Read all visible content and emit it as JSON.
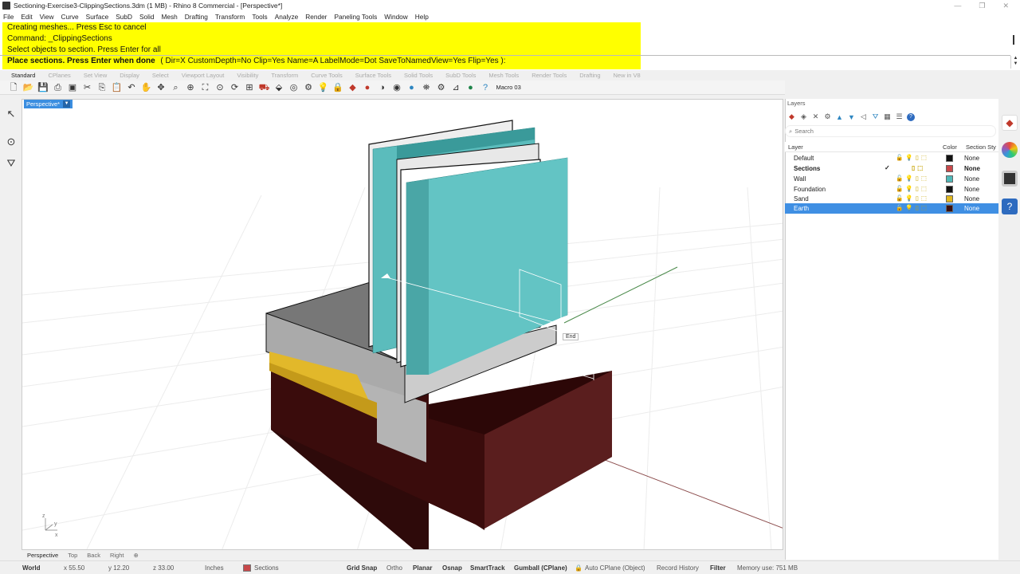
{
  "window": {
    "title": "Sectioning-Exercise3-ClippingSections.3dm (1 MB) - Rhino 8 Commercial - [Perspective*]",
    "controls": [
      "—",
      "❐",
      "✕"
    ]
  },
  "menu": [
    "File",
    "Edit",
    "View",
    "Curve",
    "Surface",
    "SubD",
    "Solid",
    "Mesh",
    "Drafting",
    "Transform",
    "Tools",
    "Analyze",
    "Render",
    "Paneling Tools",
    "Window",
    "Help"
  ],
  "command": {
    "line1": "Creating meshes... Press Esc to cancel",
    "line2": "Command: _ClippingSections",
    "line3": "Select objects to section. Press Enter for all",
    "prompt": "Place sections. Press Enter when done",
    "options": "( Dir=X  CustomDepth=No  Clip=Yes  Name=A  LabelMode=Dot  SaveToNamedView=Yes  Flip=Yes ):",
    "highlight_color": "#ffff00"
  },
  "toolbar_tabs": [
    "Standard",
    "CPlanes",
    "Set View",
    "Display",
    "Select",
    "Viewport Layout",
    "Visibility",
    "Transform",
    "Curve Tools",
    "Surface Tools",
    "Solid Tools",
    "SubD Tools",
    "Mesh Tools",
    "Render Tools",
    "Drafting",
    "New in V8"
  ],
  "toolbar_macro": "Macro 03",
  "viewport": {
    "label": "Perspective*",
    "snap_label": "End",
    "axis_z": "z",
    "axis_y": "y",
    "axis_x": "x"
  },
  "view_tabs": [
    "Perspective",
    "Top",
    "Back",
    "Right",
    "⊕"
  ],
  "status": {
    "cplane": "World",
    "x": "x 55.50",
    "y": "y 12.20",
    "z": "z 33.00",
    "units": "Inches",
    "layer": "Sections",
    "grid_snap": "Grid Snap",
    "ortho": "Ortho",
    "planar": "Planar",
    "osnap": "Osnap",
    "smarttrack": "SmartTrack",
    "gumball": "Gumball (CPlane)",
    "autocplane": "Auto CPlane (Object)",
    "record_history": "Record History",
    "filter": "Filter",
    "memory": "Memory use: 751 MB"
  },
  "layers_panel": {
    "title": "Layers",
    "search_placeholder": "Search",
    "columns": {
      "layer": "Layer",
      "color": "Color",
      "section_style": "Section Sty"
    },
    "rows": [
      {
        "name": "Default",
        "color": "#111111",
        "section": "None",
        "current": false,
        "selected": false
      },
      {
        "name": "Sections",
        "color": "#c8484a",
        "section": "None",
        "current": true,
        "selected": false
      },
      {
        "name": "Wall",
        "color": "#4fb8b8",
        "section": "None",
        "current": false,
        "selected": false
      },
      {
        "name": "Foundation",
        "color": "#111111",
        "section": "None",
        "current": false,
        "selected": false
      },
      {
        "name": "Sand",
        "color": "#e0b820",
        "section": "None",
        "current": false,
        "selected": false
      },
      {
        "name": "Earth",
        "color": "#3a1010",
        "section": "None",
        "current": false,
        "selected": true
      }
    ]
  },
  "colors": {
    "accent": "#3f8fe3",
    "wall": "#5bbcbc",
    "earth": "#4a1818",
    "sand": "#e2b82a"
  }
}
